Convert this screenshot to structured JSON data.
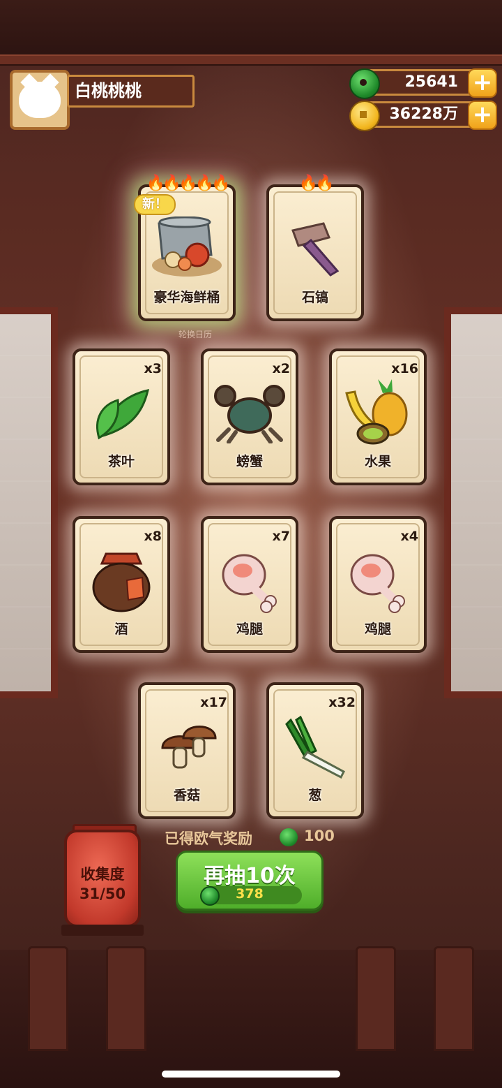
{
  "player": {
    "name": "白桃桃桃"
  },
  "currency": {
    "jade": "25641",
    "coins": "36228万",
    "plus_symbol": "+"
  },
  "featured_cards": [
    {
      "name": "豪华海鲜桶",
      "flames": "🔥🔥🔥🔥🔥",
      "badge": "新！",
      "icon": "seafood-bucket-icon"
    },
    {
      "name": "石镐",
      "flames": "🔥🔥",
      "icon": "stone-pickaxe-icon"
    }
  ],
  "caption_under_featured": "轮换日历",
  "item_cards": [
    {
      "name": "茶叶",
      "count": "x3",
      "icon": "tea-leaf-icon"
    },
    {
      "name": "螃蟹",
      "count": "x2",
      "icon": "crab-icon"
    },
    {
      "name": "水果",
      "count": "x16",
      "icon": "fruit-icon"
    },
    {
      "name": "酒",
      "count": "x8",
      "icon": "wine-jar-icon"
    },
    {
      "name": "鸡腿",
      "count": "x7",
      "icon": "chicken-leg-icon"
    },
    {
      "name": "鸡腿",
      "count": "x4",
      "icon": "chicken-leg-icon"
    },
    {
      "name": "香菇",
      "count": "x17",
      "icon": "mushroom-icon"
    },
    {
      "name": "葱",
      "count": "x32",
      "icon": "scallion-icon"
    }
  ],
  "collection": {
    "label": "收集度",
    "progress": "31/50"
  },
  "reward": {
    "text": "已得欧气奖励",
    "value": "100"
  },
  "draw_button": {
    "label": "再抽10次",
    "cost": "378"
  }
}
